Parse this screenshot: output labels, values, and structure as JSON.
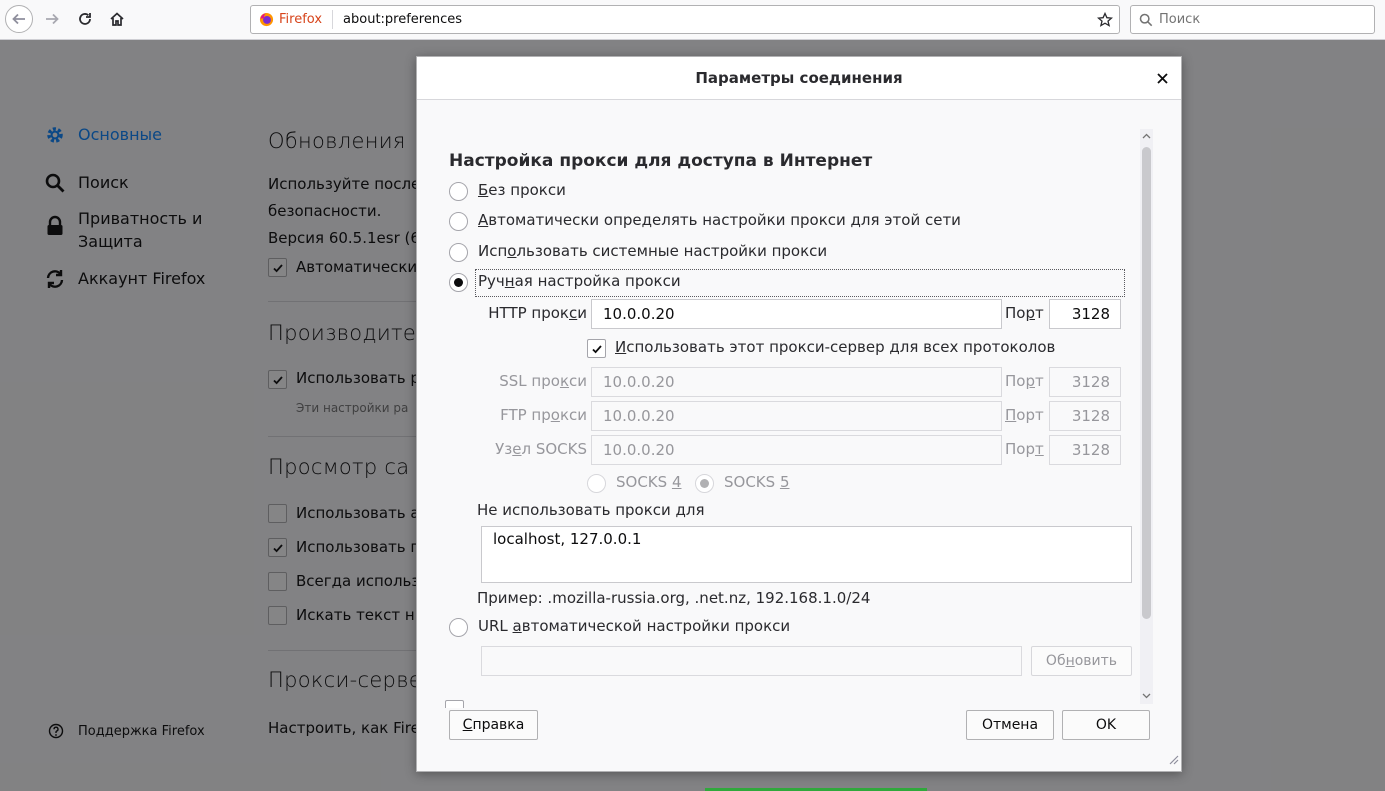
{
  "browser": {
    "identity_label": "Firefox",
    "url": "about:preferences",
    "search_placeholder": "Поиск"
  },
  "sidebar": {
    "items": [
      {
        "label": "Основные",
        "icon": "gear-icon",
        "selected": true
      },
      {
        "label": "Поиск",
        "icon": "search-icon"
      },
      {
        "label": "Приватность и",
        "label2": "Защита",
        "icon": "lock-icon"
      },
      {
        "label": "Аккаунт Firefox",
        "icon": "sync-icon"
      }
    ],
    "support_label": "Поддержка Firefox"
  },
  "main": {
    "updates_heading": "Обновления",
    "updates_text1": "Используйте после",
    "updates_text2": "безопасности.",
    "version_text": "Версия 60.5.1esr (6",
    "auto_update_label": "Автоматически",
    "perf_heading": "Производите",
    "perf_check_label": "Использовать р",
    "perf_hint": "Эти настройки ра",
    "browsing_heading": "Просмотр са",
    "browsing_items": [
      {
        "label": "Использовать а",
        "checked": false
      },
      {
        "label": "Использовать п",
        "checked": true
      },
      {
        "label": "Всегда использ",
        "checked": false
      },
      {
        "label": "Искать текст н",
        "checked": false
      }
    ],
    "proxy_heading": "Прокси-серве",
    "proxy_text": "Настроить, как Fire"
  },
  "dialog": {
    "title": "Параметры соединения",
    "section_title": "Настройка прокси для доступа в Интернет",
    "options": {
      "no_proxy": {
        "pre": "",
        "acc": "Б",
        "post": "ез прокси"
      },
      "auto_detect": {
        "pre": "",
        "acc": "А",
        "post": "втоматически определять настройки прокси для этой сети"
      },
      "system": {
        "pre": "Исп",
        "acc": "о",
        "post": "льзовать системные настройки прокси"
      },
      "manual": {
        "pre": "Руч",
        "acc": "н",
        "post": "ая настройка прокси"
      },
      "selected": "manual"
    },
    "http": {
      "pre": "HTTP прок",
      "acc": "с",
      "post": "и",
      "host": "10.0.0.20",
      "port": "3128"
    },
    "port_label": {
      "pre": "По",
      "acc": "р",
      "post": "т"
    },
    "share_all": {
      "pre": "",
      "acc": "И",
      "post": "спользовать этот прокси-сервер для всех протоколов",
      "checked": true
    },
    "ssl": {
      "pre": "SSL про",
      "acc": "к",
      "post": "си",
      "host": "10.0.0.20",
      "port": "3128"
    },
    "ftp": {
      "pre": "FTP пр",
      "acc": "о",
      "post": "кси",
      "host": "10.0.0.20",
      "port": "3128"
    },
    "socks": {
      "pre": "Уз",
      "acc": "е",
      "post": "л SOCKS",
      "host": "10.0.0.20",
      "port": "3128"
    },
    "ssl_port_label": {
      "pre": "По",
      "acc": "р",
      "post": "т"
    },
    "ftp_port_label": {
      "pre": "",
      "acc": "П",
      "post": "орт"
    },
    "socks_port_label": {
      "pre": "Пор",
      "acc": "т",
      "post": ""
    },
    "socks4": {
      "pre": "SOCKS ",
      "acc": "4",
      "post": ""
    },
    "socks5": {
      "pre": "SOCKS ",
      "acc": "5",
      "post": ""
    },
    "no_proxy_for": {
      "pre": "Не использовать прокси ",
      "acc": "д",
      "post": "ля"
    },
    "no_proxy_value": "localhost, 127.0.0.1",
    "example": "Пример: .mozilla-russia.org, .net.nz, 192.168.1.0/24",
    "autoconfig": {
      "pre": "URL ",
      "acc": "а",
      "post": "втоматической настройки прокси"
    },
    "autoconfig_value": "",
    "reload": {
      "pre": "Об",
      "acc": "н",
      "post": "овить"
    },
    "help": {
      "pre": "",
      "acc": "С",
      "post": "правка"
    },
    "cancel_label": "Отмена",
    "ok_label": "OK"
  }
}
